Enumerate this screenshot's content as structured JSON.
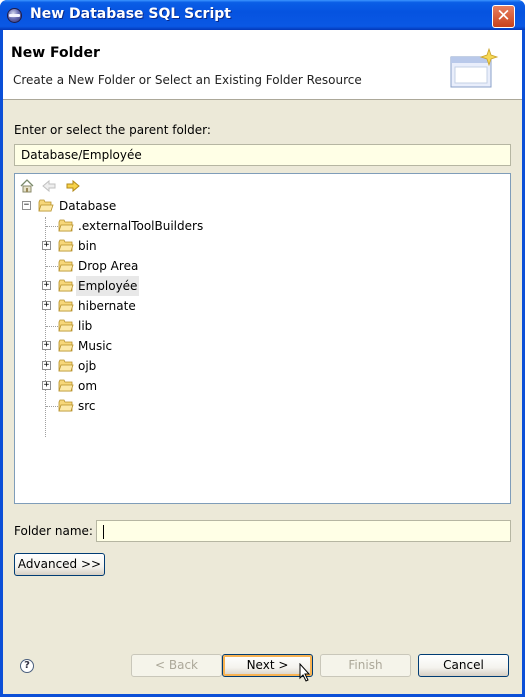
{
  "window": {
    "title": "New Database SQL Script",
    "close_glyph": "✕"
  },
  "header": {
    "title": "New Folder",
    "description": "Create a New Folder or Select an Existing Folder Resource",
    "icon": "new-folder-wizard-icon"
  },
  "parent_folder": {
    "label": "Enter or select the parent folder:",
    "value": "Database/Employée"
  },
  "tree": {
    "toolbar": [
      "home-icon",
      "back-arrow-icon",
      "forward-arrow-icon"
    ],
    "root": {
      "label": "Database",
      "expanded": true
    },
    "children": [
      {
        "label": ".externalToolBuilders",
        "expandable": false,
        "selected": false
      },
      {
        "label": "bin",
        "expandable": true,
        "selected": false
      },
      {
        "label": "Drop Area",
        "expandable": false,
        "selected": false
      },
      {
        "label": "Employée",
        "expandable": true,
        "selected": true
      },
      {
        "label": "hibernate",
        "expandable": true,
        "selected": false
      },
      {
        "label": "lib",
        "expandable": false,
        "selected": false
      },
      {
        "label": "Music",
        "expandable": true,
        "selected": false
      },
      {
        "label": "ojb",
        "expandable": true,
        "selected": false
      },
      {
        "label": "om",
        "expandable": true,
        "selected": false
      },
      {
        "label": "src",
        "expandable": false,
        "selected": false
      }
    ]
  },
  "folder_name": {
    "label": "Folder name:",
    "value": ""
  },
  "buttons": {
    "advanced": "Advanced >>",
    "back": "< Back",
    "next": "Next >",
    "finish": "Finish",
    "cancel": "Cancel"
  },
  "colors": {
    "title_bar": "#0653e0",
    "dialog_bg": "#ece9d8",
    "field_bg": "#ffffe6",
    "selection": "#e8e8e8"
  }
}
